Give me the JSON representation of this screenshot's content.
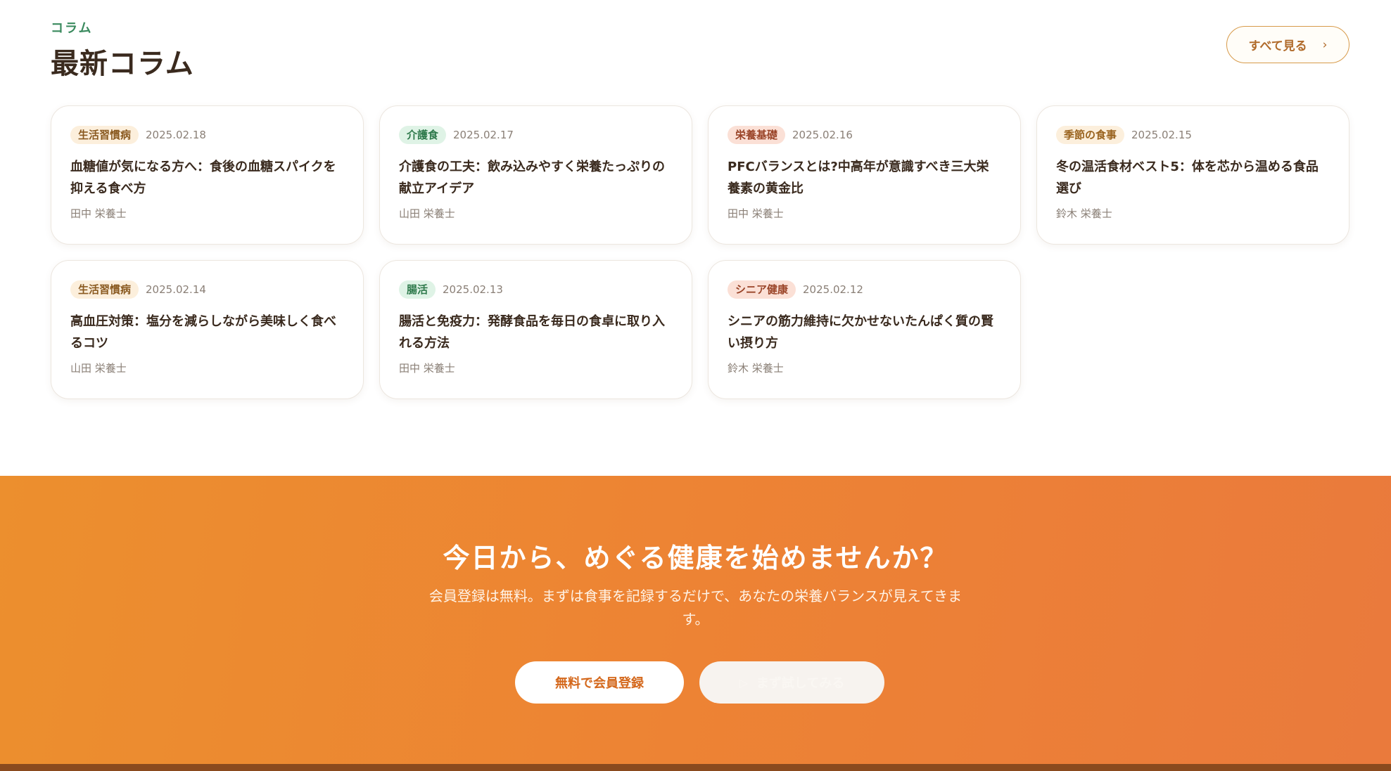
{
  "columns_section": {
    "eyebrow": "コラム",
    "title": "最新コラム",
    "see_all_label": "すべて見る",
    "see_all_icon": "chevron-right-icon",
    "cards": [
      {
        "tag": "生活習慣病",
        "tag_style": "lifestyle",
        "date": "2025.02.18",
        "title": "血糖値が気になる方へ：食後の血糖スパイクを抑える食べ方",
        "author": "田中 栄養士"
      },
      {
        "tag": "介護食",
        "tag_style": "care",
        "date": "2025.02.17",
        "title": "介護食の工夫：飲み込みやすく栄養たっぷりの献立アイデア",
        "author": "山田 栄養士"
      },
      {
        "tag": "栄養基礎",
        "tag_style": "nutrition",
        "date": "2025.02.16",
        "title": "PFCバランスとは?中高年が意識すべき三大栄養素の黄金比",
        "author": "田中 栄養士"
      },
      {
        "tag": "季節の食事",
        "tag_style": "season",
        "date": "2025.02.15",
        "title": "冬の温活食材ベスト5：体を芯から温める食品選び",
        "author": "鈴木 栄養士"
      },
      {
        "tag": "生活習慣病",
        "tag_style": "lifestyle",
        "date": "2025.02.14",
        "title": "高血圧対策：塩分を減らしながら美味しく食べるコツ",
        "author": "山田 栄養士"
      },
      {
        "tag": "腸活",
        "tag_style": "gut",
        "date": "2025.02.13",
        "title": "腸活と免疫力：発酵食品を毎日の食卓に取り入れる方法",
        "author": "田中 栄養士"
      },
      {
        "tag": "シニア健康",
        "tag_style": "senior",
        "date": "2025.02.12",
        "title": "シニアの筋力維持に欠かせないたんぱく質の賢い摂り方",
        "author": "鈴木 栄養士"
      }
    ]
  },
  "cta": {
    "title": "今日から、めぐる健康を始めませんか？",
    "description": "会員登録は無料。まずは食事を記録するだけで、あなたの栄養バランスが見えてきます。",
    "primary_label": "無料で会員登録",
    "secondary_label": "まず試してみる",
    "secondary_icon": "play-icon"
  },
  "colors": {
    "accent_green": "#3a8a5e",
    "cta_orange": "#ed8334",
    "button_text_orange": "#d4681c"
  }
}
